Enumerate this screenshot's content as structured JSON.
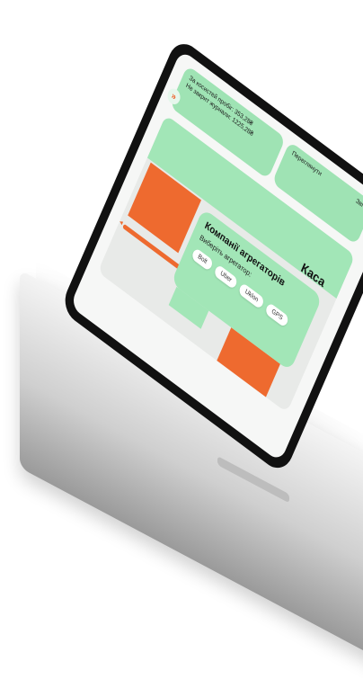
{
  "top_card": {
    "line1": "За косистей пробіг: 353,28₴",
    "line2": "Не закрит журнали: 1225,28₴"
  },
  "top_card_2": {
    "label": "Переглянути",
    "right": "Звіт"
  },
  "kasa_label": "Каса",
  "aggregators": {
    "title": "Компанії агрегаторів",
    "subtitle": "Виберіть агрегатор:",
    "options": [
      "Bolt",
      "Uber",
      "Uklon",
      "GPS"
    ]
  },
  "progress": {
    "fraction": 1.0
  },
  "colors": {
    "green": "#a2e6b7",
    "orange": "#ee6a2f",
    "frame": "#111111"
  }
}
